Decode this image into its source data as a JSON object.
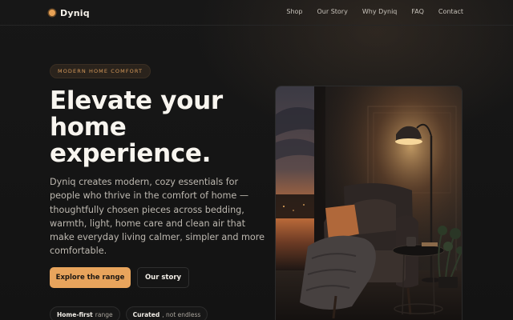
{
  "brand": {
    "name": "Dyniq",
    "dot_color": "#e8a256"
  },
  "nav": {
    "links": [
      "Shop",
      "Our Story",
      "Why Dyniq",
      "FAQ",
      "Contact"
    ]
  },
  "hero": {
    "eyebrow": "MODERN HOME COMFORT",
    "headline": "Elevate your home experience.",
    "lede": "Dyniq creates modern, cozy essentials for people who thrive in the comfort of home — thoughtfully chosen pieces across bedding, warmth, light, home care and clean air that make everyday living calmer, simpler and more comfortable.",
    "primary_cta": "Explore the range",
    "secondary_cta": "Our story",
    "chips": [
      {
        "strong": "Home-first",
        "rest": "range"
      },
      {
        "strong": "Curated",
        "rest": ", not endless"
      }
    ],
    "image_icon": "armchair-lamp-photo"
  },
  "colors": {
    "accent": "#e8a45c",
    "background": "#141414",
    "eyebrow_text": "#d79a5a"
  }
}
